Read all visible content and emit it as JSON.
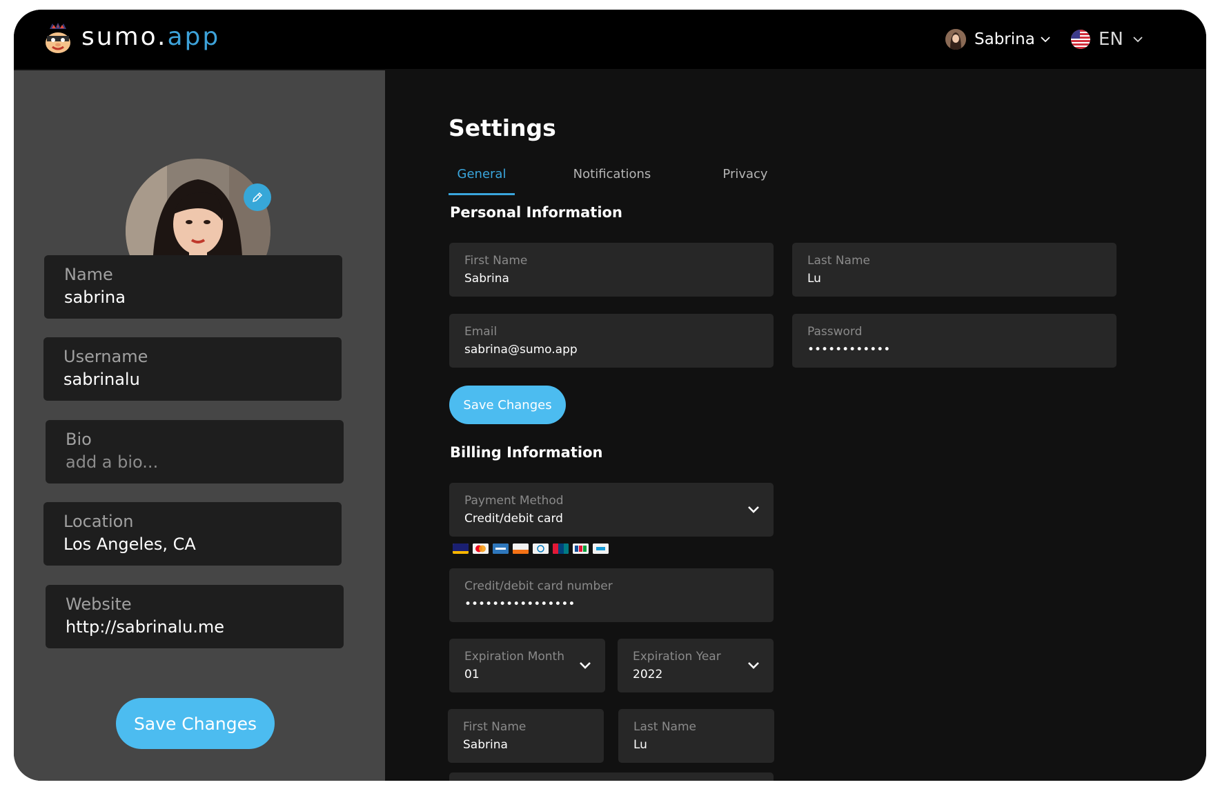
{
  "header": {
    "logo_text": "sumo.",
    "logo_tld": "app",
    "user_name": "Sabrina",
    "language": "EN"
  },
  "sidebar": {
    "fields": [
      {
        "label": "Name",
        "value": "sabrina"
      },
      {
        "label": "Username",
        "value": "sabrinalu"
      },
      {
        "label": "Bio",
        "placeholder": "add a bio..."
      },
      {
        "label": "Location",
        "value": "Los Angeles, CA"
      },
      {
        "label": "Website",
        "value": "http://sabrinalu.me"
      }
    ],
    "save_label": "Save Changes"
  },
  "main": {
    "title": "Settings",
    "tabs": [
      {
        "label": "General",
        "active": true
      },
      {
        "label": "Notifications",
        "active": false
      },
      {
        "label": "Privacy",
        "active": false
      }
    ],
    "personal": {
      "title": "Personal Information",
      "first_name": {
        "label": "First Name",
        "value": "Sabrina"
      },
      "last_name": {
        "label": "Last Name",
        "value": "Lu"
      },
      "email": {
        "label": "Email",
        "value": "sabrina@sumo.app"
      },
      "password": {
        "label": "Password",
        "value": "••••••••••••"
      },
      "save_label": "Save Changes"
    },
    "billing": {
      "title": "Billing Information",
      "payment_method": {
        "label": "Payment Method",
        "value": "Credit/debit card"
      },
      "card_brands": [
        "visa-icon",
        "mastercard-icon",
        "amex-icon",
        "discover-icon",
        "diners-icon",
        "unionpay-icon",
        "jcb-icon",
        "paypal-icon"
      ],
      "card_number": {
        "label": "Credit/debit card number",
        "value": "••••••••••••••••"
      },
      "exp_month": {
        "label": "Expiration Month",
        "value": "01"
      },
      "exp_year": {
        "label": "Expiration Year",
        "value": "2022"
      },
      "first_name": {
        "label": "First Name",
        "value": "Sabrina"
      },
      "last_name": {
        "label": "Last Name",
        "value": "Lu"
      }
    }
  },
  "colors": {
    "accent": "#3aa6dd",
    "button": "#4cbcf0",
    "sidebar_bg": "#464646",
    "main_bg": "#111111",
    "field_bg": "#272727"
  }
}
